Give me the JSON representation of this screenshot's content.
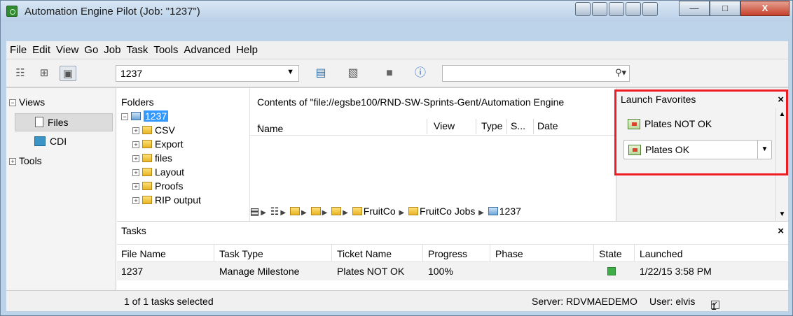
{
  "window": {
    "title": "Automation Engine Pilot (Job: \"1237\")",
    "minimize_label": "—",
    "maximize_label": "□",
    "close_label": "X"
  },
  "menubar": {
    "items": [
      "File",
      "Edit",
      "View",
      "Go",
      "Job",
      "Task",
      "Tools",
      "Advanced",
      "Help"
    ]
  },
  "toolbar": {
    "job_value": "1237",
    "search_value": ""
  },
  "views": {
    "header": "Views",
    "files_label": "Files",
    "cdi_label": "CDI",
    "tools_label": "Tools"
  },
  "folders": {
    "header": "Folders",
    "root": "1237",
    "items": [
      "CSV",
      "Export",
      "files",
      "Layout",
      "Proofs",
      "RIP output"
    ]
  },
  "contents": {
    "header": "Contents of \"file://egsbe100/RND-SW-Sprints-Gent/Automation Engine",
    "columns": [
      "Name",
      "View",
      "Type",
      "S...",
      "Date"
    ],
    "sort_indicator": "^",
    "breadcrumb": [
      "FruitCo",
      "FruitCo Jobs",
      "1237"
    ]
  },
  "launch_favorites": {
    "header": "Launch Favorites",
    "items": [
      "Plates NOT OK",
      "Plates OK"
    ]
  },
  "tasks": {
    "header": "Tasks",
    "columns": [
      "File Name",
      "Task Type",
      "Ticket Name",
      "Progress",
      "Phase",
      "State",
      "Launched"
    ],
    "rows": [
      {
        "file_name": "1237",
        "task_type": "Manage Milestone",
        "ticket_name": "Plates NOT OK",
        "progress": "100%",
        "phase": "",
        "state": "done",
        "launched": "1/22/15 3:58 PM"
      }
    ]
  },
  "statusbar": {
    "selection": "1 of 1 tasks selected",
    "server": "Server: RDVMAEDEMO",
    "user": "User: elvis",
    "count": "1"
  },
  "colors": {
    "highlight_box": "#ee1c25",
    "selection": "#3399ff",
    "state_ok": "#3fae49"
  }
}
